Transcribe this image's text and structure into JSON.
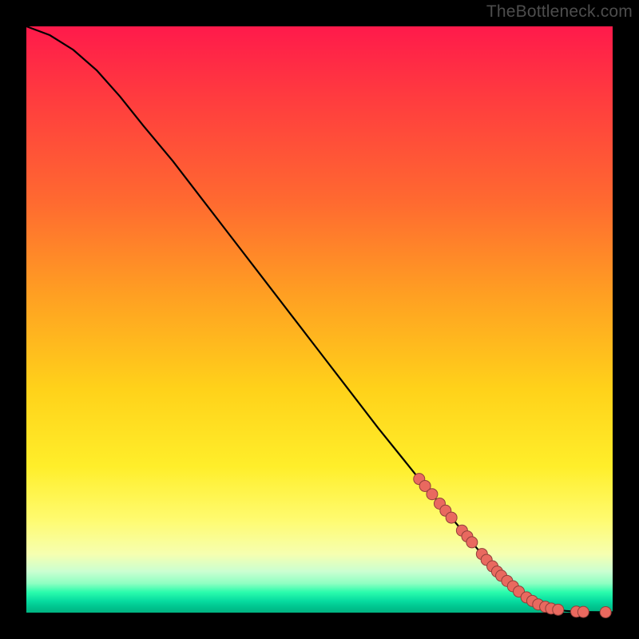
{
  "watermark": "TheBottleneck.com",
  "chart_data": {
    "type": "line",
    "title": "",
    "xlabel": "",
    "ylabel": "",
    "xlim": [
      0,
      100
    ],
    "ylim": [
      0,
      100
    ],
    "grid": false,
    "curve": [
      {
        "x": 0.0,
        "y": 100.0
      },
      {
        "x": 4.0,
        "y": 98.5
      },
      {
        "x": 8.0,
        "y": 96.0
      },
      {
        "x": 12.0,
        "y": 92.5
      },
      {
        "x": 16.0,
        "y": 88.0
      },
      {
        "x": 20.0,
        "y": 83.0
      },
      {
        "x": 25.0,
        "y": 77.0
      },
      {
        "x": 30.0,
        "y": 70.5
      },
      {
        "x": 35.0,
        "y": 64.0
      },
      {
        "x": 40.0,
        "y": 57.5
      },
      {
        "x": 45.0,
        "y": 51.0
      },
      {
        "x": 50.0,
        "y": 44.5
      },
      {
        "x": 55.0,
        "y": 38.0
      },
      {
        "x": 60.0,
        "y": 31.5
      },
      {
        "x": 65.0,
        "y": 25.3
      },
      {
        "x": 67.0,
        "y": 22.8
      },
      {
        "x": 70.0,
        "y": 19.2
      },
      {
        "x": 73.0,
        "y": 15.6
      },
      {
        "x": 76.0,
        "y": 12.0
      },
      {
        "x": 78.0,
        "y": 9.6
      },
      {
        "x": 80.0,
        "y": 7.4
      },
      {
        "x": 82.0,
        "y": 5.4
      },
      {
        "x": 84.0,
        "y": 3.6
      },
      {
        "x": 86.0,
        "y": 2.2
      },
      {
        "x": 88.0,
        "y": 1.2
      },
      {
        "x": 90.0,
        "y": 0.6
      },
      {
        "x": 92.0,
        "y": 0.3
      },
      {
        "x": 94.0,
        "y": 0.15
      },
      {
        "x": 96.0,
        "y": 0.1
      },
      {
        "x": 98.0,
        "y": 0.08
      },
      {
        "x": 100.0,
        "y": 0.07
      }
    ],
    "points": [
      {
        "x": 67.0,
        "y": 22.8
      },
      {
        "x": 68.0,
        "y": 21.6
      },
      {
        "x": 69.2,
        "y": 20.2
      },
      {
        "x": 70.5,
        "y": 18.6
      },
      {
        "x": 71.5,
        "y": 17.4
      },
      {
        "x": 72.5,
        "y": 16.2
      },
      {
        "x": 74.3,
        "y": 14.0
      },
      {
        "x": 75.2,
        "y": 13.0
      },
      {
        "x": 76.0,
        "y": 12.0
      },
      {
        "x": 77.7,
        "y": 10.0
      },
      {
        "x": 78.5,
        "y": 9.0
      },
      {
        "x": 79.5,
        "y": 7.9
      },
      {
        "x": 80.3,
        "y": 7.0
      },
      {
        "x": 81.0,
        "y": 6.3
      },
      {
        "x": 82.0,
        "y": 5.4
      },
      {
        "x": 83.0,
        "y": 4.5
      },
      {
        "x": 84.0,
        "y": 3.6
      },
      {
        "x": 85.3,
        "y": 2.6
      },
      {
        "x": 86.3,
        "y": 2.0
      },
      {
        "x": 87.3,
        "y": 1.4
      },
      {
        "x": 88.5,
        "y": 1.0
      },
      {
        "x": 89.5,
        "y": 0.7
      },
      {
        "x": 90.7,
        "y": 0.5
      },
      {
        "x": 93.8,
        "y": 0.17
      },
      {
        "x": 95.0,
        "y": 0.12
      },
      {
        "x": 98.8,
        "y": 0.07
      }
    ],
    "curve_color": "#000000",
    "point_color": "#e9695f",
    "point_stroke": "#913f3a"
  }
}
